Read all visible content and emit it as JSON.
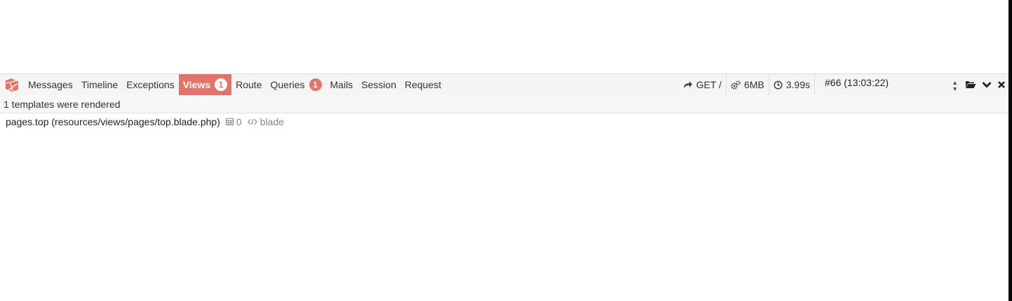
{
  "colors": {
    "accent": "#e4746a",
    "toolbar_bg": "#f5f5f5"
  },
  "brand": {
    "icon": "laravel-logo-icon"
  },
  "tabs": [
    {
      "label": "Messages"
    },
    {
      "label": "Timeline"
    },
    {
      "label": "Exceptions"
    },
    {
      "label": "Views",
      "badge": "1",
      "active": true
    },
    {
      "label": "Route"
    },
    {
      "label": "Queries",
      "badge": "1"
    },
    {
      "label": "Mails"
    },
    {
      "label": "Session"
    },
    {
      "label": "Request"
    }
  ],
  "indicators": {
    "route": {
      "icon": "share-arrow-icon",
      "text": "GET /"
    },
    "memory": {
      "icon": "gears-icon",
      "text": "6MB"
    },
    "time": {
      "icon": "clock-icon",
      "text": "3.99s"
    }
  },
  "request_select": {
    "value": "#66 (13:03:22)"
  },
  "controls": {
    "open": "folder-open-icon",
    "minimize": "chevron-down-icon",
    "close": "close-icon"
  },
  "panel": {
    "status": "1 templates were rendered",
    "templates": [
      {
        "name": "pages.top (resources/views/pages/top.blade.php)",
        "params_count": "0",
        "type": "blade"
      }
    ]
  }
}
